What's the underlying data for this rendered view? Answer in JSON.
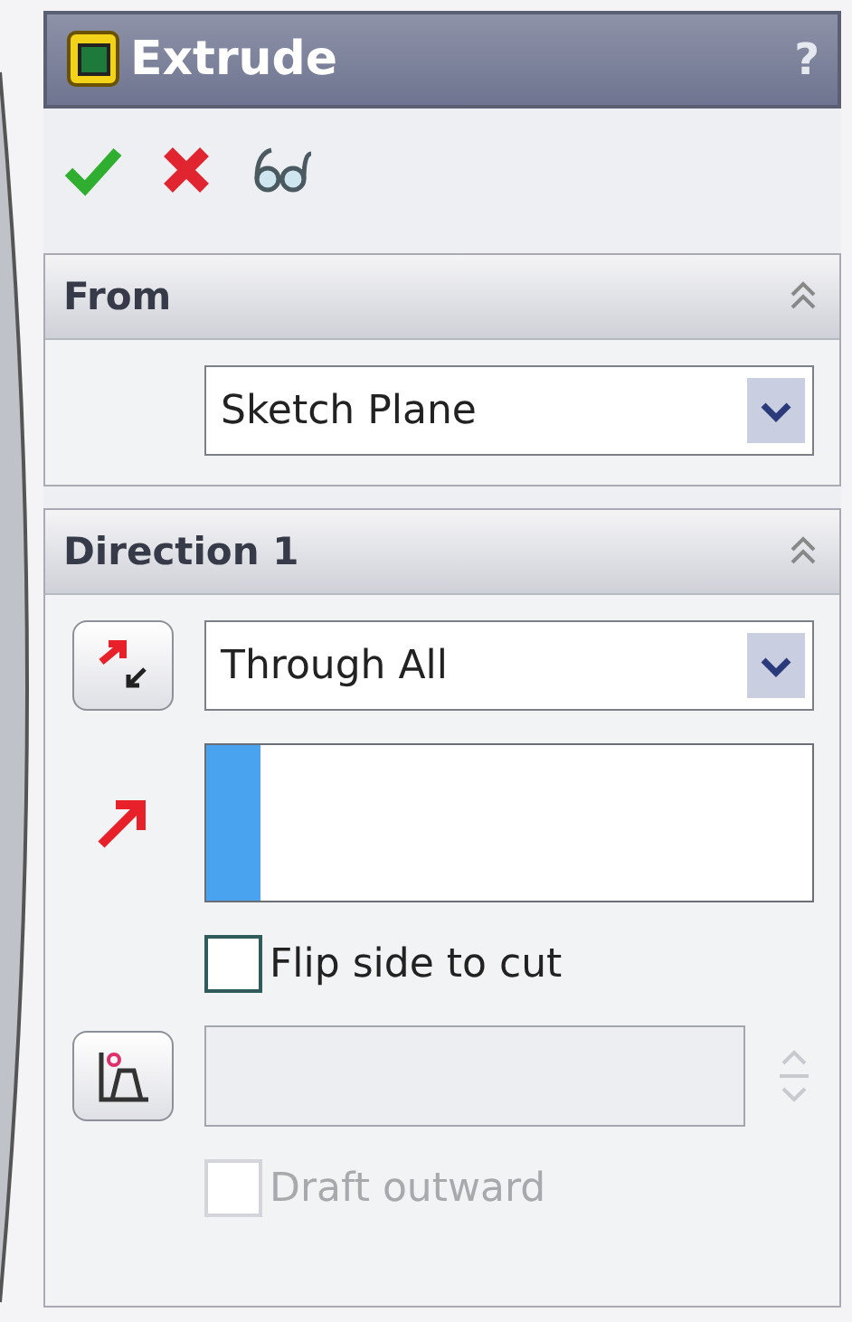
{
  "title": "Extrude",
  "help": "?",
  "sections": [
    {
      "title": "From",
      "expanded": true,
      "rows": [
        {
          "kind": "dropdown",
          "value": "Sketch Plane"
        }
      ]
    },
    {
      "title": "Direction 1",
      "expanded": true,
      "rows": [
        {
          "kind": "reverse",
          "value": "Through All"
        },
        {
          "kind": "selection"
        },
        {
          "kind": "checkbox",
          "label": "Flip side to cut",
          "checked": false,
          "disabled": false
        },
        {
          "kind": "draft",
          "disabled": true
        },
        {
          "kind": "checkbox",
          "label": "Draft outward",
          "checked": false,
          "disabled": true
        }
      ]
    }
  ]
}
